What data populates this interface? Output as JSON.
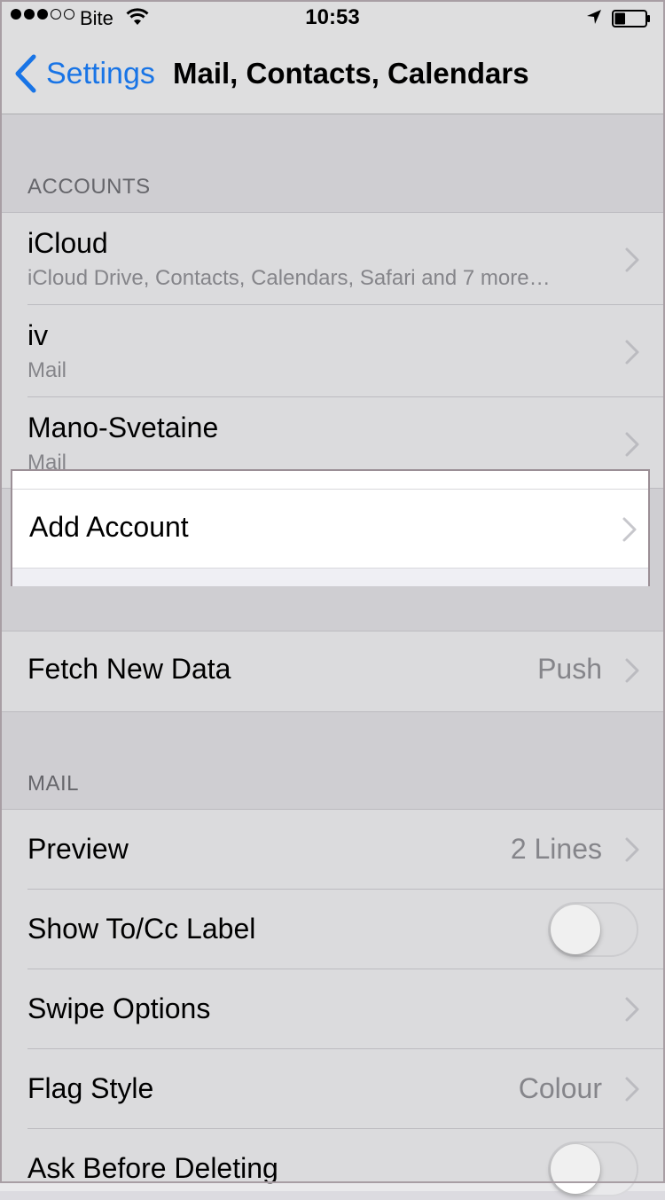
{
  "status_bar": {
    "signal_filled": 3,
    "signal_empty": 2,
    "carrier": "Bite",
    "time": "10:53",
    "wifi_icon": "wifi-icon",
    "location_icon": "location-arrow-icon",
    "battery_icon": "battery-icon",
    "battery_level": 0.35
  },
  "nav": {
    "back_label": "Settings",
    "title": "Mail, Contacts, Calendars",
    "accent": "#1a7cf5"
  },
  "accounts": {
    "header": "ACCOUNTS",
    "items": [
      {
        "title": "iCloud",
        "subtitle": "iCloud Drive, Contacts, Calendars, Safari and 7 more…"
      },
      {
        "title": "iv",
        "subtitle": "Mail"
      },
      {
        "title": "Mano-Svetaine",
        "subtitle": "Mail"
      }
    ],
    "add_account": "Add Account"
  },
  "fetch": {
    "label": "Fetch New Data",
    "value": "Push"
  },
  "mail": {
    "header": "MAIL",
    "preview": {
      "label": "Preview",
      "value": "2 Lines"
    },
    "show_tocc": {
      "label": "Show To/Cc Label",
      "on": false
    },
    "swipe": {
      "label": "Swipe Options"
    },
    "flag_style": {
      "label": "Flag Style",
      "value": "Colour"
    },
    "ask_delete": {
      "label": "Ask Before Deleting",
      "on": false
    }
  }
}
